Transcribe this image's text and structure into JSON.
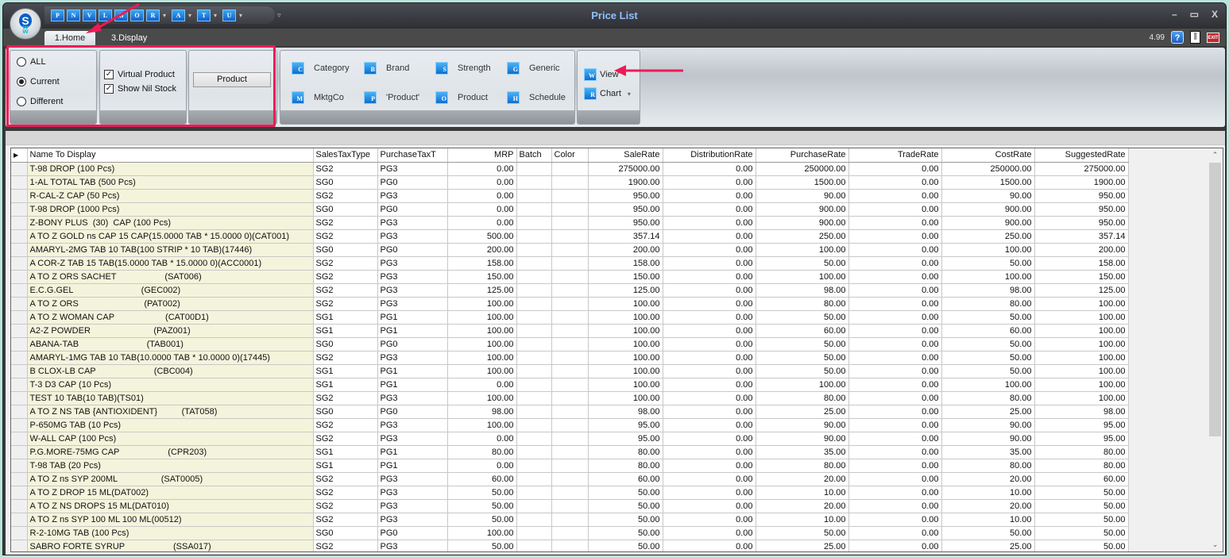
{
  "window": {
    "title": "Price List",
    "version": "4.99",
    "controls": {
      "minimize": "–",
      "maximize": "▭",
      "close": "X"
    }
  },
  "quick_access": [
    {
      "label": "P",
      "dropdown": false
    },
    {
      "label": "N",
      "dropdown": false
    },
    {
      "label": "V",
      "dropdown": false
    },
    {
      "label": "L",
      "dropdown": false
    },
    {
      "label": "G",
      "dropdown": false
    },
    {
      "label": "O",
      "dropdown": false
    },
    {
      "label": "R",
      "dropdown": true
    },
    {
      "label": "A",
      "dropdown": true
    },
    {
      "label": "T",
      "dropdown": true
    },
    {
      "label": "U",
      "dropdown": true
    }
  ],
  "tabs": [
    {
      "label": "1.Home",
      "active": true
    },
    {
      "label": "3.Display",
      "active": false
    }
  ],
  "icons": {
    "help": "?",
    "exit": "EXIT",
    "app_logo": "S"
  },
  "ribbon": {
    "scope_options": [
      {
        "label": "ALL",
        "selected": false
      },
      {
        "label": "Current",
        "selected": true
      },
      {
        "label": "Different",
        "selected": false
      }
    ],
    "checkboxes": [
      {
        "label": "Virtual Product",
        "checked": true
      },
      {
        "label": "Show Nil Stock",
        "checked": true
      }
    ],
    "product_button": "Product",
    "filters": [
      {
        "label": "Category",
        "icon": "C"
      },
      {
        "label": "Brand",
        "icon": "B"
      },
      {
        "label": "Strength",
        "icon": "S"
      },
      {
        "label": "Generic",
        "icon": "G"
      },
      {
        "label": "MktgCo",
        "icon": "M"
      },
      {
        "label": "'Product'",
        "icon": "P"
      },
      {
        "label": "Product",
        "icon": "O"
      },
      {
        "label": "Schedule",
        "icon": "H"
      }
    ],
    "view": {
      "label": "View",
      "icon": "W"
    },
    "chart": {
      "label": "Chart",
      "icon": "R"
    }
  },
  "grid": {
    "columns": [
      "Name To Display",
      "SalesTaxType",
      "PurchaseTaxT",
      "MRP",
      "Batch",
      "Color",
      "SaleRate",
      "DistributionRate",
      "PurchaseRate",
      "TradeRate",
      "CostRate",
      "SuggestedRate"
    ],
    "rows": [
      [
        "T-98 DROP (100 Pcs)",
        "SG2",
        "PG3",
        "0.00",
        "",
        "",
        "275000.00",
        "0.00",
        "250000.00",
        "0.00",
        "250000.00",
        "275000.00"
      ],
      [
        "1-AL TOTAL TAB (500 Pcs)",
        "SG0",
        "PG0",
        "0.00",
        "",
        "",
        "1900.00",
        "0.00",
        "1500.00",
        "0.00",
        "1500.00",
        "1900.00"
      ],
      [
        "R-CAL-Z CAP (50 Pcs)",
        "SG2",
        "PG3",
        "0.00",
        "",
        "",
        "950.00",
        "0.00",
        "90.00",
        "0.00",
        "90.00",
        "950.00"
      ],
      [
        "T-98 DROP (1000 Pcs)",
        "SG0",
        "PG0",
        "0.00",
        "",
        "",
        "950.00",
        "0.00",
        "900.00",
        "0.00",
        "900.00",
        "950.00"
      ],
      [
        "Z-BONY PLUS  (30)  CAP (100 Pcs)",
        "SG2",
        "PG3",
        "0.00",
        "",
        "",
        "950.00",
        "0.00",
        "900.00",
        "0.00",
        "900.00",
        "950.00"
      ],
      [
        "A TO Z GOLD ns CAP 15 CAP(15.0000 TAB * 15.0000 0)(CAT001)",
        "SG2",
        "PG3",
        "500.00",
        "",
        "",
        "357.14",
        "0.00",
        "250.00",
        "0.00",
        "250.00",
        "357.14"
      ],
      [
        "AMARYL-2MG TAB 10 TAB(100 STRIP * 10 TAB)(17446)",
        "SG0",
        "PG0",
        "200.00",
        "",
        "",
        "200.00",
        "0.00",
        "100.00",
        "0.00",
        "100.00",
        "200.00"
      ],
      [
        "A COR-Z TAB 15 TAB(15.0000 TAB * 15.0000 0)(ACC0001)",
        "SG2",
        "PG3",
        "158.00",
        "",
        "",
        "158.00",
        "0.00",
        "50.00",
        "0.00",
        "50.00",
        "158.00"
      ],
      [
        "A TO Z ORS SACHET                    (SAT006)",
        "SG2",
        "PG3",
        "150.00",
        "",
        "",
        "150.00",
        "0.00",
        "100.00",
        "0.00",
        "100.00",
        "150.00"
      ],
      [
        "E.C.G.GEL                            (GEC002)",
        "SG2",
        "PG3",
        "125.00",
        "",
        "",
        "125.00",
        "0.00",
        "98.00",
        "0.00",
        "98.00",
        "125.00"
      ],
      [
        "A TO Z ORS                           (PAT002)",
        "SG2",
        "PG3",
        "100.00",
        "",
        "",
        "100.00",
        "0.00",
        "80.00",
        "0.00",
        "80.00",
        "100.00"
      ],
      [
        "A TO Z WOMAN CAP                     (CAT00D1)",
        "SG1",
        "PG1",
        "100.00",
        "",
        "",
        "100.00",
        "0.00",
        "50.00",
        "0.00",
        "50.00",
        "100.00"
      ],
      [
        "A2-Z POWDER                          (PAZ001)",
        "SG1",
        "PG1",
        "100.00",
        "",
        "",
        "100.00",
        "0.00",
        "60.00",
        "0.00",
        "60.00",
        "100.00"
      ],
      [
        "ABANA-TAB                            (TAB001)",
        "SG0",
        "PG0",
        "100.00",
        "",
        "",
        "100.00",
        "0.00",
        "50.00",
        "0.00",
        "50.00",
        "100.00"
      ],
      [
        "AMARYL-1MG TAB 10 TAB(10.0000 TAB * 10.0000 0)(17445)",
        "SG2",
        "PG3",
        "100.00",
        "",
        "",
        "100.00",
        "0.00",
        "50.00",
        "0.00",
        "50.00",
        "100.00"
      ],
      [
        "B CLOX-LB CAP                        (CBC004)",
        "SG1",
        "PG1",
        "100.00",
        "",
        "",
        "100.00",
        "0.00",
        "50.00",
        "0.00",
        "50.00",
        "100.00"
      ],
      [
        "T-3 D3 CAP (10 Pcs)",
        "SG1",
        "PG1",
        "0.00",
        "",
        "",
        "100.00",
        "0.00",
        "100.00",
        "0.00",
        "100.00",
        "100.00"
      ],
      [
        "TEST 10 TAB(10 TAB)(TS01)",
        "SG2",
        "PG3",
        "100.00",
        "",
        "",
        "100.00",
        "0.00",
        "80.00",
        "0.00",
        "80.00",
        "100.00"
      ],
      [
        "A TO Z NS TAB {ANTIOXIDENT}          (TAT058)",
        "SG0",
        "PG0",
        "98.00",
        "",
        "",
        "98.00",
        "0.00",
        "25.00",
        "0.00",
        "25.00",
        "98.00"
      ],
      [
        "P-650MG TAB (10 Pcs)",
        "SG2",
        "PG3",
        "100.00",
        "",
        "",
        "95.00",
        "0.00",
        "90.00",
        "0.00",
        "90.00",
        "95.00"
      ],
      [
        "W-ALL CAP (100 Pcs)",
        "SG2",
        "PG3",
        "0.00",
        "",
        "",
        "95.00",
        "0.00",
        "90.00",
        "0.00",
        "90.00",
        "95.00"
      ],
      [
        "P.G.MORE-75MG CAP                    (CPR203)",
        "SG1",
        "PG1",
        "80.00",
        "",
        "",
        "80.00",
        "0.00",
        "35.00",
        "0.00",
        "35.00",
        "80.00"
      ],
      [
        "T-98 TAB (20 Pcs)",
        "SG1",
        "PG1",
        "0.00",
        "",
        "",
        "80.00",
        "0.00",
        "80.00",
        "0.00",
        "80.00",
        "80.00"
      ],
      [
        "A TO Z ns SYP 200ML                  (SAT0005)",
        "SG2",
        "PG3",
        "60.00",
        "",
        "",
        "60.00",
        "0.00",
        "20.00",
        "0.00",
        "20.00",
        "60.00"
      ],
      [
        "A TO Z DROP 15 ML(DAT002)",
        "SG2",
        "PG3",
        "50.00",
        "",
        "",
        "50.00",
        "0.00",
        "10.00",
        "0.00",
        "10.00",
        "50.00"
      ],
      [
        "A TO Z NS DROPS 15 ML(DAT010)",
        "SG2",
        "PG3",
        "50.00",
        "",
        "",
        "50.00",
        "0.00",
        "20.00",
        "0.00",
        "20.00",
        "50.00"
      ],
      [
        "A TO Z ns SYP 100 ML 100 ML(00512)",
        "SG2",
        "PG3",
        "50.00",
        "",
        "",
        "50.00",
        "0.00",
        "10.00",
        "0.00",
        "10.00",
        "50.00"
      ],
      [
        "R-2-10MG TAB (100 Pcs)",
        "SG0",
        "PG0",
        "100.00",
        "",
        "",
        "50.00",
        "0.00",
        "50.00",
        "0.00",
        "50.00",
        "50.00"
      ],
      [
        "SABRO FORTE SYRUP                    (SSA017)",
        "SG2",
        "PG3",
        "50.00",
        "",
        "",
        "50.00",
        "0.00",
        "25.00",
        "0.00",
        "25.00",
        "50.00"
      ]
    ]
  },
  "colors": {
    "annotation": "#ee1a55",
    "title": "#8fc0ff",
    "name_column_bg": "#f4f4dc"
  }
}
